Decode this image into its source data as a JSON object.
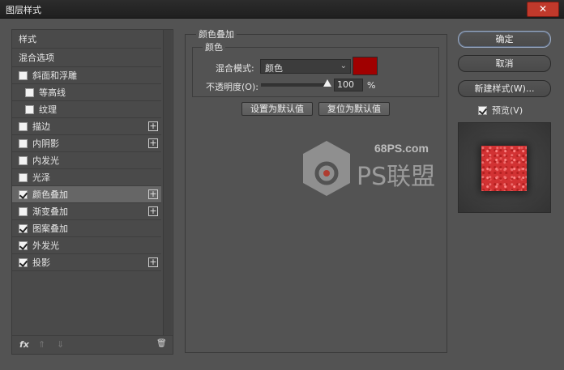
{
  "window": {
    "title": "图层样式",
    "close_glyph": "✕"
  },
  "sidebar": {
    "items": [
      {
        "label": "样式",
        "checkbox": false,
        "checked": false,
        "plus": false,
        "selected": false,
        "header": true
      },
      {
        "label": "混合选项",
        "checkbox": false,
        "checked": false,
        "plus": false,
        "selected": false,
        "header": true
      },
      {
        "label": "斜面和浮雕",
        "checkbox": true,
        "checked": false,
        "plus": false,
        "selected": false
      },
      {
        "label": "等高线",
        "checkbox": true,
        "checked": false,
        "plus": false,
        "selected": false,
        "sub": true
      },
      {
        "label": "纹理",
        "checkbox": true,
        "checked": false,
        "plus": false,
        "selected": false,
        "sub": true
      },
      {
        "label": "描边",
        "checkbox": true,
        "checked": false,
        "plus": true,
        "selected": false
      },
      {
        "label": "内阴影",
        "checkbox": true,
        "checked": false,
        "plus": true,
        "selected": false
      },
      {
        "label": "内发光",
        "checkbox": true,
        "checked": false,
        "plus": false,
        "selected": false
      },
      {
        "label": "光泽",
        "checkbox": true,
        "checked": false,
        "plus": false,
        "selected": false
      },
      {
        "label": "颜色叠加",
        "checkbox": true,
        "checked": true,
        "plus": true,
        "selected": true
      },
      {
        "label": "渐变叠加",
        "checkbox": true,
        "checked": false,
        "plus": true,
        "selected": false
      },
      {
        "label": "图案叠加",
        "checkbox": true,
        "checked": true,
        "plus": false,
        "selected": false
      },
      {
        "label": "外发光",
        "checkbox": true,
        "checked": true,
        "plus": false,
        "selected": false
      },
      {
        "label": "投影",
        "checkbox": true,
        "checked": true,
        "plus": true,
        "selected": false
      }
    ],
    "tools": {
      "fx": "fx",
      "up": "⇑",
      "down": "⇓",
      "trash": "🗑"
    }
  },
  "color_overlay": {
    "section_title": "颜色叠加",
    "group_title": "颜色",
    "blend_mode_label": "混合模式:",
    "blend_mode_value": "颜色",
    "blend_color": "#a00000",
    "opacity_label": "不透明度(O):",
    "opacity_value": "100",
    "opacity_unit": "%",
    "set_default_label": "设置为默认值",
    "reset_default_label": "复位为默认值"
  },
  "actions": {
    "ok_label": "确定",
    "cancel_label": "取消",
    "new_style_label": "新建样式(W)...",
    "preview_label": "预览(V)",
    "preview_checked": true
  },
  "watermark": {
    "site": "68PS.com",
    "brand": "PS联盟"
  },
  "colors": {
    "dialog_bg": "#535353",
    "titlebar_bg": "#262626",
    "accent_red": "#d23233"
  }
}
